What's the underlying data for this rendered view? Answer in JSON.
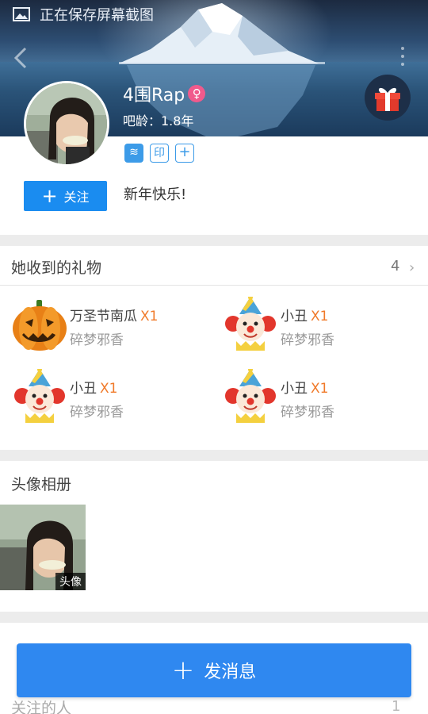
{
  "status_bar": {
    "text": "正在保存屏幕截图",
    "icon": "image-icon"
  },
  "header": {
    "back_icon": "chevron-left-icon",
    "more_icon": "more-vertical-icon",
    "gift_icon": "gift-icon"
  },
  "profile": {
    "username": "4围Rap",
    "gender_symbol": "♀",
    "age_label": "吧龄：1.8年",
    "badges": [
      "≋",
      "印",
      "+"
    ],
    "follow_label": "关注",
    "signature": "新年快乐!"
  },
  "gifts": {
    "title": "她收到的礼物",
    "count": "4",
    "items": [
      {
        "name": "万圣节南瓜",
        "qty": "X1",
        "sender": "碎梦邪香",
        "icon": "pumpkin-icon"
      },
      {
        "name": "小丑",
        "qty": "X1",
        "sender": "碎梦邪香",
        "icon": "clown-icon"
      },
      {
        "name": "小丑",
        "qty": "X1",
        "sender": "碎梦邪香",
        "icon": "clown-icon"
      },
      {
        "name": "小丑",
        "qty": "X1",
        "sender": "碎梦邪香",
        "icon": "clown-icon"
      }
    ]
  },
  "album": {
    "title": "头像相册",
    "thumb_tag": "头像"
  },
  "following": {
    "title": "关注的人",
    "count": "1"
  },
  "send_message": {
    "label": "发消息"
  },
  "colors": {
    "accent": "#1a8cf0",
    "gift_qty": "#f07a2a",
    "gender": "#f05a8c"
  }
}
